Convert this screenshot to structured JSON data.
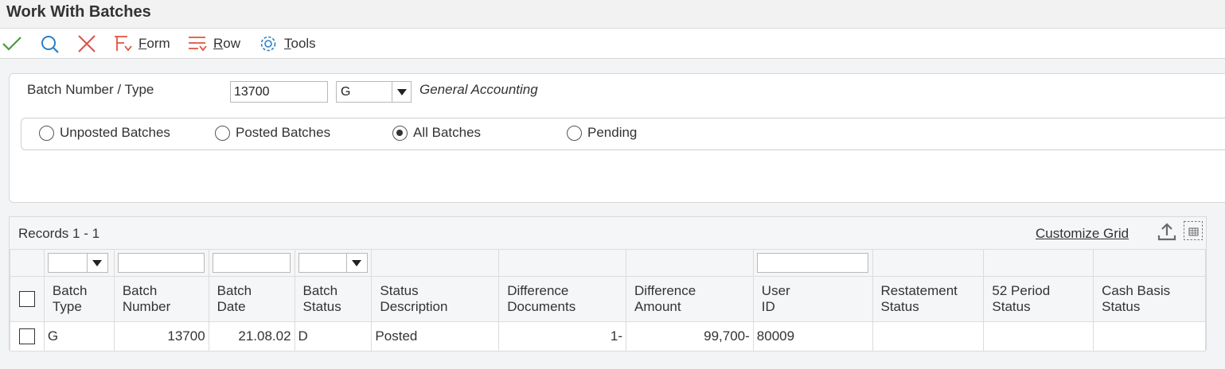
{
  "window": {
    "title": "Work With Batches"
  },
  "toolbar": {
    "form_label_first": "F",
    "form_label_rest": "orm",
    "row_label_first": "R",
    "row_label_rest": "ow",
    "tools_label_first": "T",
    "tools_label_rest": "ools",
    "colors": {
      "ok": "#4a9a3a",
      "find": "#2a7fc9",
      "close": "#d9534f",
      "menu": "#e0533d"
    }
  },
  "form": {
    "batch_label": "Batch Number / Type",
    "batch_number": "13700",
    "batch_type": "G",
    "batch_type_desc": "General Accounting",
    "radios": [
      {
        "label": "Unposted Batches",
        "selected": false
      },
      {
        "label": "Posted Batches",
        "selected": false
      },
      {
        "label": "All Batches",
        "selected": true
      },
      {
        "label": "Pending",
        "selected": false
      }
    ]
  },
  "grid": {
    "records_label": "Records 1 - 1",
    "customize_label": "Customize Grid",
    "columns": [
      [
        "Batch",
        "Type"
      ],
      [
        "Batch",
        "Number"
      ],
      [
        "Batch",
        "Date"
      ],
      [
        "Batch",
        "Status"
      ],
      [
        "Status",
        "Description"
      ],
      [
        "Difference",
        "Documents"
      ],
      [
        "Difference",
        "Amount"
      ],
      [
        "User",
        "ID"
      ],
      [
        "Restatement",
        "Status"
      ],
      [
        "52 Period",
        "Status"
      ],
      [
        "Cash Basis",
        "Status"
      ]
    ],
    "rows": [
      [
        "G",
        "13700",
        "21.08.02",
        "D",
        "Posted",
        "1-",
        "99,700-",
        "80009",
        "",
        "",
        ""
      ]
    ]
  }
}
